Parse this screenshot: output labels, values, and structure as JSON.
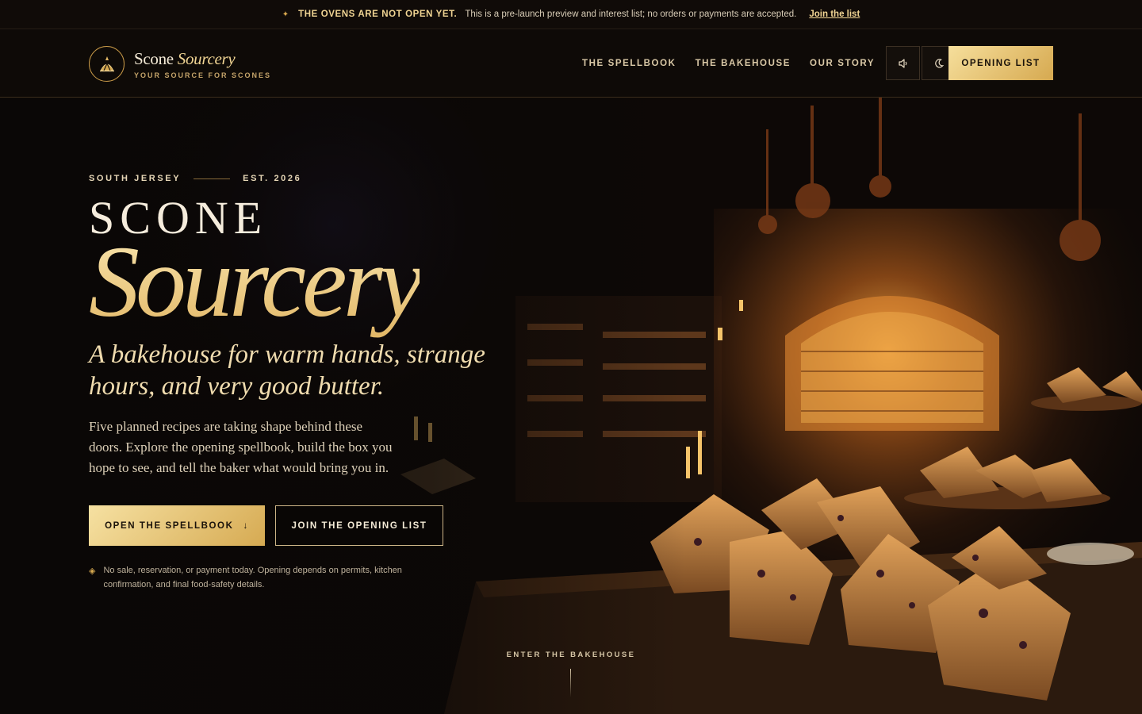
{
  "announcement": {
    "icon": "sparkle-icon",
    "headline": "THE OVENS ARE NOT OPEN YET.",
    "message": "This is a pre-launch preview and interest list; no orders or payments are accepted.",
    "link_label": "Join the list"
  },
  "header": {
    "brand_name": "Scone",
    "brand_name_italic": "Sourcery",
    "brand_tagline": "YOUR SOURCE FOR SCONES",
    "nav": [
      {
        "label": "THE SPELLBOOK"
      },
      {
        "label": "THE BAKEHOUSE"
      },
      {
        "label": "OUR STORY"
      }
    ],
    "sound_icon": "speaker-icon",
    "theme_icon": "moon-icon",
    "cta_label": "OPENING LIST"
  },
  "hero": {
    "location": "SOUTH JERSEY",
    "established": "EST. 2026",
    "title_top": "SCONE",
    "title_bottom": "Sourcery",
    "subtitle": "A bakehouse for warm hands, strange hours, and very good butter.",
    "body": "Five planned recipes are taking shape behind these doors. Explore the opening spellbook, build the box you hope to see, and tell the baker what would bring you in.",
    "primary_cta": "OPEN THE SPELLBOOK",
    "primary_cta_arrow": "↓",
    "secondary_cta": "JOIN THE OPENING LIST",
    "notice": "No sale, reservation, or payment today. Opening depends on permits, kitchen confirmation, and final food-safety details.",
    "scroll_label": "ENTER THE BAKEHOUSE"
  },
  "colors": {
    "accent_gold": "#f0d493",
    "gold_deep": "#d6a950",
    "background": "#0a0706"
  }
}
